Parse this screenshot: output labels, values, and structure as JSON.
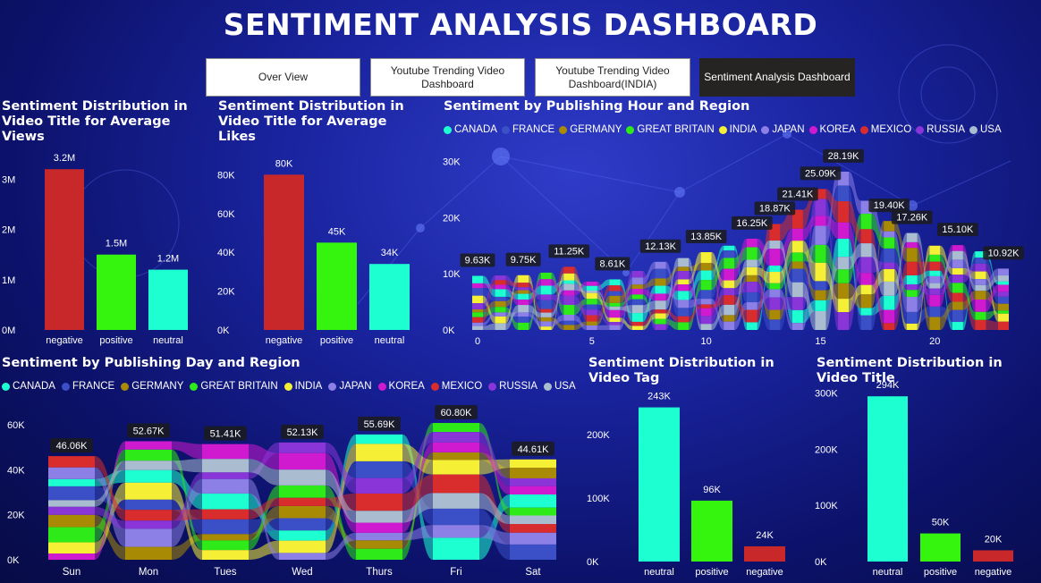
{
  "header": {
    "title": "SENTIMENT ANALYSIS DASHBOARD"
  },
  "nav": {
    "buttons": [
      {
        "label": "Over View",
        "state": "default"
      },
      {
        "label": "Youtube Trending Video Dashboard",
        "state": "default"
      },
      {
        "label": "Youtube Trending Video Dashboard(INDIA)",
        "state": "default"
      },
      {
        "label": "Sentiment Analysis Dashboard",
        "state": "selected"
      }
    ]
  },
  "colors": {
    "negative": "#c8282a",
    "positive": "#35f50f",
    "neutral": "#1dffd0",
    "regions": {
      "CANADA": "#1dffd0",
      "FRANCE": "#3b4fc6",
      "GERMANY": "#a88a05",
      "GREAT BRITAIN": "#2dea18",
      "INDIA": "#f5ef35",
      "JAPAN": "#8c7fe6",
      "KOREA": "#d01ad0",
      "MEXICO": "#d92d2d",
      "RUSSIA": "#8a35d8",
      "USA": "#a9bcd0"
    }
  },
  "legend_regions": [
    "CANADA",
    "FRANCE",
    "GERMANY",
    "GREAT BRITAIN",
    "INDIA",
    "JAPAN",
    "KOREA",
    "MEXICO",
    "RUSSIA",
    "USA"
  ],
  "chart_data": [
    {
      "id": "avg_views",
      "type": "bar",
      "title": "Sentiment Distribution in Video Title for Average Views",
      "categories": [
        "negative",
        "positive",
        "neutral"
      ],
      "values": [
        3200000,
        1500000,
        1200000
      ],
      "data_labels": [
        "3.2M",
        "1.5M",
        "1.2M"
      ],
      "yticks": [
        0,
        1000000,
        2000000,
        3000000
      ],
      "ytick_labels": [
        "0M",
        "1M",
        "2M",
        "3M"
      ],
      "ylim": [
        0,
        3400000
      ]
    },
    {
      "id": "avg_likes",
      "type": "bar",
      "title": "Sentiment Distribution in Video Title for Average Likes",
      "categories": [
        "negative",
        "positive",
        "neutral"
      ],
      "values": [
        80000,
        45000,
        34000
      ],
      "data_labels": [
        "80K",
        "45K",
        "34K"
      ],
      "yticks": [
        0,
        20000,
        40000,
        60000,
        80000
      ],
      "ytick_labels": [
        "0K",
        "20K",
        "40K",
        "60K",
        "80K"
      ],
      "ylim": [
        0,
        88000
      ]
    },
    {
      "id": "hour_region",
      "type": "area",
      "stacked": true,
      "title": "Sentiment by Publishing Hour and Region",
      "legend": "top",
      "x": [
        0,
        1,
        2,
        3,
        4,
        5,
        6,
        7,
        8,
        9,
        10,
        11,
        12,
        13,
        14,
        15,
        16,
        17,
        18,
        19,
        20,
        21,
        22,
        23
      ],
      "xticks": [
        0,
        5,
        10,
        15,
        20
      ],
      "yticks": [
        0,
        10000,
        20000,
        30000
      ],
      "ytick_labels": [
        "0K",
        "10K",
        "20K",
        "30K"
      ],
      "ylim": [
        0,
        32000
      ],
      "totals": [
        9630,
        9700,
        9750,
        10200,
        11250,
        8610,
        9000,
        10500,
        12130,
        12800,
        13850,
        15000,
        16250,
        18870,
        21410,
        25090,
        28190,
        23000,
        19400,
        17260,
        15000,
        15100,
        14000,
        10920
      ],
      "total_labels": [
        {
          "x": 0,
          "text": "9.63K"
        },
        {
          "x": 2,
          "text": "9.75K"
        },
        {
          "x": 4,
          "text": "11.25K"
        },
        {
          "x": 5.9,
          "text": "8.61K"
        },
        {
          "x": 8,
          "text": "12.13K"
        },
        {
          "x": 10,
          "text": "13.85K"
        },
        {
          "x": 12,
          "text": "16.25K"
        },
        {
          "x": 13,
          "text": "18.87K"
        },
        {
          "x": 14,
          "text": "21.41K"
        },
        {
          "x": 15,
          "text": "25.09K"
        },
        {
          "x": 16,
          "text": "28.19K"
        },
        {
          "x": 18,
          "text": "19.40K"
        },
        {
          "x": 19,
          "text": "17.26K"
        },
        {
          "x": 21,
          "text": "15.10K"
        },
        {
          "x": 23,
          "text": "10.92K"
        }
      ]
    },
    {
      "id": "day_region",
      "type": "area",
      "stacked": true,
      "title": "Sentiment by Publishing Day and Region",
      "legend": "top",
      "categories": [
        "Sun",
        "Mon",
        "Tues",
        "Wed",
        "Thurs",
        "Fri",
        "Sat"
      ],
      "totals": [
        46060,
        52670,
        51410,
        52130,
        55690,
        60800,
        44610
      ],
      "data_labels": [
        "46.06K",
        "52.67K",
        "51.41K",
        "52.13K",
        "55.69K",
        "60.80K",
        "44.61K"
      ],
      "yticks": [
        0,
        20000,
        40000,
        60000
      ],
      "ytick_labels": [
        "0K",
        "20K",
        "40K",
        "60K"
      ],
      "ylim": [
        0,
        62000
      ]
    },
    {
      "id": "video_tag",
      "type": "bar",
      "title": "Sentiment Distribution in Video Tag",
      "categories": [
        "neutral",
        "positive",
        "negative"
      ],
      "values": [
        243000,
        96000,
        24000
      ],
      "data_labels": [
        "243K",
        "96K",
        "24K"
      ],
      "yticks": [
        0,
        100000,
        200000
      ],
      "ytick_labels": [
        "0K",
        "100K",
        "200K"
      ],
      "ylim": [
        0,
        265000
      ]
    },
    {
      "id": "video_title",
      "type": "bar",
      "title": "Sentiment Distribution in Video Title",
      "categories": [
        "neutral",
        "positive",
        "negative"
      ],
      "values": [
        294000,
        50000,
        20000
      ],
      "data_labels": [
        "294K",
        "50K",
        "20K"
      ],
      "yticks": [
        0,
        100000,
        200000,
        300000
      ],
      "ytick_labels": [
        "0K",
        "100K",
        "200K",
        "300K"
      ],
      "ylim": [
        0,
        315000
      ]
    }
  ]
}
